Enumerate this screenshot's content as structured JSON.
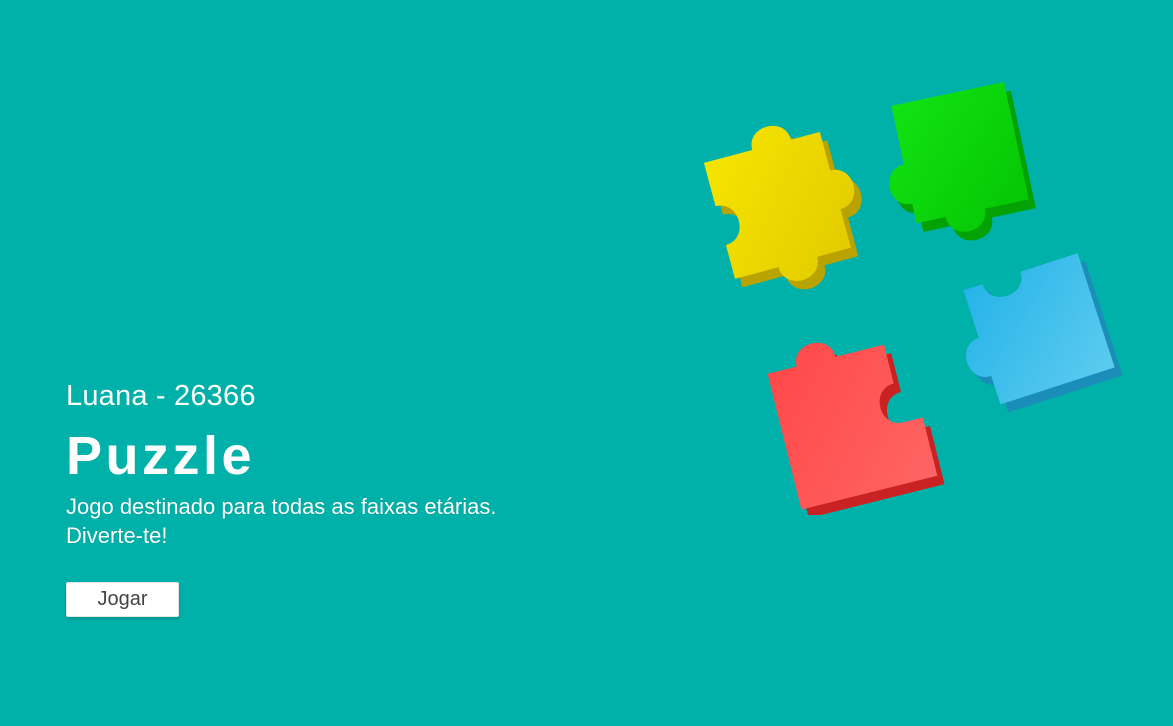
{
  "hero": {
    "author": "Luana - 26366",
    "title": "Puzzle",
    "description_line1": "Jogo destinado para todas as faixas etárias.",
    "description_line2": "Diverte-te!",
    "play_button_label": "Jogar"
  },
  "illustration": {
    "icon": "puzzle-pieces-icon",
    "colors": {
      "yellow": "#f0dd00",
      "green": "#08db08",
      "blue": "#38bde9",
      "red": "#ff3b3b"
    }
  },
  "theme": {
    "background": "#00b1a9",
    "text": "#ffffff"
  }
}
